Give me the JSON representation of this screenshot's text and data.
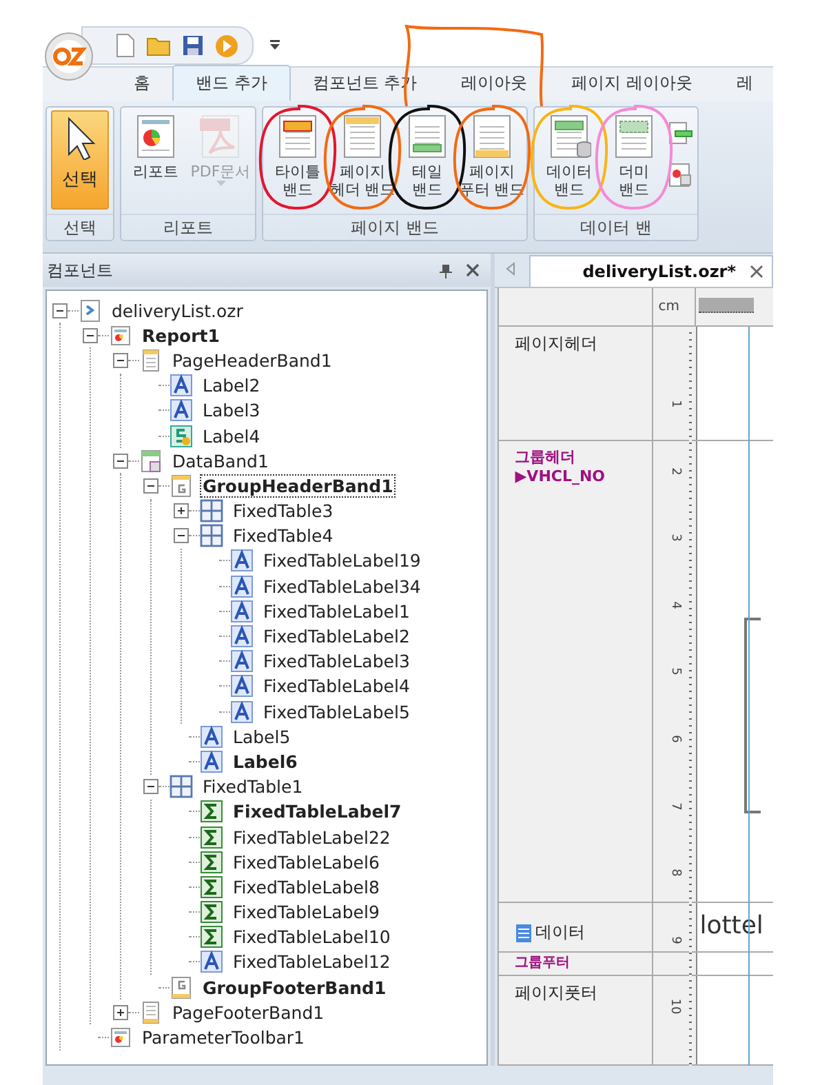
{
  "tabs": [
    {
      "label": "홈",
      "selected": false
    },
    {
      "label": "밴드 추가",
      "selected": true
    },
    {
      "label": "컴포넌트 추가",
      "selected": false
    },
    {
      "label": "레이아웃",
      "selected": false
    },
    {
      "label": "페이지 레이아웃",
      "selected": false
    },
    {
      "label": "레",
      "selected": false
    }
  ],
  "ribbon_groups": [
    {
      "title": "선택",
      "buttons": [
        {
          "label": "선택",
          "kind": "select",
          "selected": true
        }
      ]
    },
    {
      "title": "리포트",
      "buttons": [
        {
          "label": "리포트",
          "kind": "report",
          "selected": false
        },
        {
          "label": "PDF문서",
          "kind": "pdf",
          "selected": false,
          "disabled": true
        }
      ]
    },
    {
      "title": "페이지 밴드",
      "buttons": [
        {
          "label": "타이틀\n밴드",
          "kind": "title_band",
          "selected": false,
          "color": "#e3162e"
        },
        {
          "label": "페이지\n헤더 밴드",
          "kind": "page_header_band",
          "selected": false,
          "color": "#f26a12"
        },
        {
          "label": "테일\n밴드",
          "kind": "tail_band",
          "selected": false,
          "color": "#111111"
        },
        {
          "label": "페이지\n푸터 밴드",
          "kind": "page_footer_band",
          "selected": false,
          "color": "#f26a12"
        }
      ]
    },
    {
      "title": "데이터 밴",
      "buttons": [
        {
          "label": "데이터\n밴드",
          "kind": "data_band",
          "selected": false,
          "color": "#f8b514"
        },
        {
          "label": "더미\n밴드",
          "kind": "dummy_band",
          "selected": false,
          "color": "#f58ad6"
        },
        {
          "kind": "small_icons"
        }
      ]
    }
  ],
  "annotations": [
    {
      "kind": "connector",
      "color": "#f26a12"
    }
  ],
  "panel": {
    "title": "컴포넌트",
    "tree": [
      {
        "label": "deliveryList.ozr",
        "kind": "file",
        "bold": false,
        "selected": false,
        "expanded": true,
        "children": [
          {
            "label": "Report1",
            "kind": "report",
            "bold": true,
            "selected": false,
            "expanded": true,
            "children": [
              {
                "label": "PageHeaderBand1",
                "kind": "page_header",
                "bold": false,
                "selected": false,
                "expanded": true,
                "children": [
                  {
                    "label": "Label2",
                    "kind": "label",
                    "bold": false,
                    "selected": false
                  },
                  {
                    "label": "Label3",
                    "kind": "label",
                    "bold": false,
                    "selected": false
                  },
                  {
                    "label": "Label4",
                    "kind": "script_label",
                    "bold": false,
                    "selected": false
                  }
                ]
              },
              {
                "label": "DataBand1",
                "kind": "data_band",
                "bold": false,
                "selected": false,
                "expanded": true,
                "children": [
                  {
                    "label": "GroupHeaderBand1",
                    "kind": "group_header",
                    "bold": true,
                    "selected": true,
                    "expanded": true,
                    "children": [
                      {
                        "label": "FixedTable3",
                        "kind": "table",
                        "bold": false,
                        "selected": false,
                        "expanded": false
                      },
                      {
                        "label": "FixedTable4",
                        "kind": "table",
                        "bold": false,
                        "selected": false,
                        "expanded": true,
                        "children": [
                          {
                            "label": "FixedTableLabel19",
                            "kind": "label",
                            "bold": false,
                            "selected": false
                          },
                          {
                            "label": "FixedTableLabel34",
                            "kind": "label",
                            "bold": false,
                            "selected": false
                          },
                          {
                            "label": "FixedTableLabel1",
                            "kind": "label",
                            "bold": false,
                            "selected": false
                          },
                          {
                            "label": "FixedTableLabel2",
                            "kind": "label",
                            "bold": false,
                            "selected": false
                          },
                          {
                            "label": "FixedTableLabel3",
                            "kind": "label",
                            "bold": false,
                            "selected": false
                          },
                          {
                            "label": "FixedTableLabel4",
                            "kind": "label",
                            "bold": false,
                            "selected": false
                          },
                          {
                            "label": "FixedTableLabel5",
                            "kind": "label",
                            "bold": false,
                            "selected": false
                          }
                        ]
                      },
                      {
                        "label": "Label5",
                        "kind": "label",
                        "bold": false,
                        "selected": false
                      },
                      {
                        "label": "Label6",
                        "kind": "label",
                        "bold": true,
                        "selected": false
                      }
                    ]
                  },
                  {
                    "label": "FixedTable1",
                    "kind": "table",
                    "bold": false,
                    "selected": false,
                    "expanded": true,
                    "children": [
                      {
                        "label": "FixedTableLabel7",
                        "kind": "sum",
                        "bold": true,
                        "selected": false
                      },
                      {
                        "label": "FixedTableLabel22",
                        "kind": "sum",
                        "bold": false,
                        "selected": false
                      },
                      {
                        "label": "FixedTableLabel6",
                        "kind": "sum",
                        "bold": false,
                        "selected": false
                      },
                      {
                        "label": "FixedTableLabel8",
                        "kind": "sum",
                        "bold": false,
                        "selected": false
                      },
                      {
                        "label": "FixedTableLabel9",
                        "kind": "sum",
                        "bold": false,
                        "selected": false
                      },
                      {
                        "label": "FixedTableLabel10",
                        "kind": "sum",
                        "bold": false,
                        "selected": false
                      },
                      {
                        "label": "FixedTableLabel12",
                        "kind": "label",
                        "bold": false,
                        "selected": false
                      }
                    ]
                  },
                  {
                    "label": "GroupFooterBand1",
                    "kind": "group_footer",
                    "bold": true,
                    "selected": false
                  }
                ]
              },
              {
                "label": "PageFooterBand1",
                "kind": "page_footer",
                "bold": false,
                "selected": false,
                "expanded": false
              }
            ]
          },
          {
            "label": "ParameterToolbar1",
            "kind": "report",
            "bold": false,
            "selected": false
          }
        ]
      }
    ]
  },
  "document_tab": {
    "label": "deliveryList.ozr*",
    "selected": true
  },
  "ruler": {
    "unit": "cm",
    "marks": [
      "1",
      "2",
      "3",
      "4",
      "5",
      "6",
      "7",
      "8",
      "9",
      "10"
    ]
  },
  "bands": [
    {
      "kind": "page_header",
      "label": "페이지헤더"
    },
    {
      "kind": "group_header",
      "label": "그룹헤더",
      "field": "▶VHCL_NO"
    },
    {
      "kind": "data",
      "label": "데이터",
      "content": "lottel"
    },
    {
      "kind": "group_footer",
      "label": "그룹푸터"
    },
    {
      "kind": "page_footer",
      "label": "페이지풋터"
    }
  ]
}
